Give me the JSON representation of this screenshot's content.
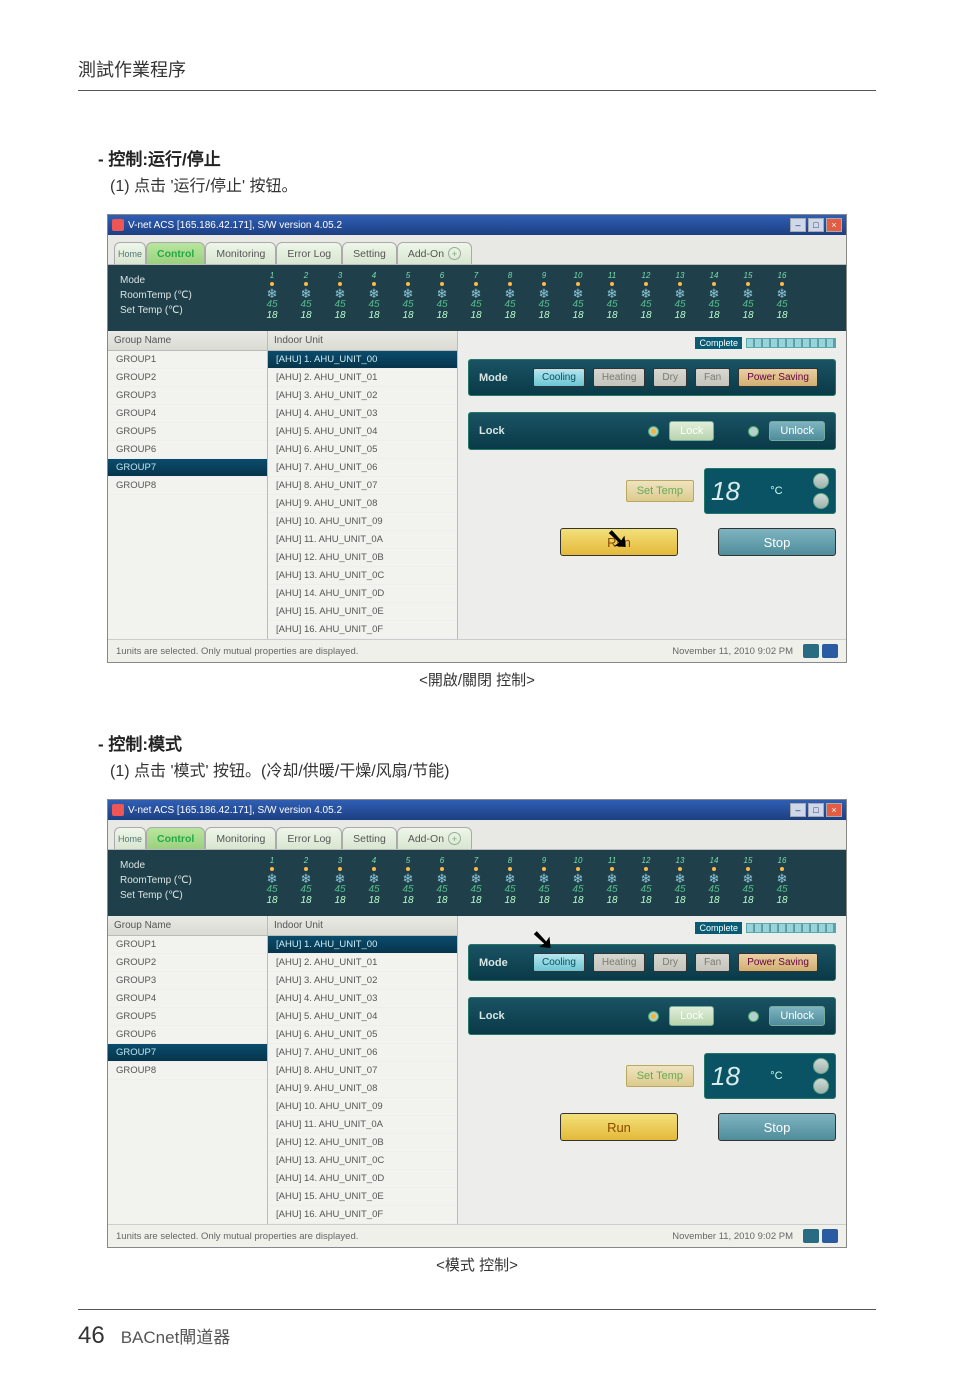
{
  "doc": {
    "header": "測試作業程序",
    "page_number": "46",
    "footer_title": "BACnet閘道器"
  },
  "section1": {
    "heading": "- 控制:运行/停止",
    "desc": "(1) 点击 '运行/停止' 按钮。",
    "caption": "<開啟/關閉 控制>"
  },
  "section2": {
    "heading": "- 控制:模式",
    "desc": "(1) 点击 '模式' 按钮。(冷却/供暖/干燥/风扇/节能)",
    "caption": "<模式 控制>"
  },
  "win": {
    "title": "V-net ACS [165.186.42.171],  S/W version 4.05.2",
    "tabs": {
      "home_icon": "Home",
      "control": "Control",
      "monitoring": "Monitoring",
      "errorlog": "Error Log",
      "setting": "Setting",
      "addon": "Add-On"
    },
    "strip": {
      "mode": "Mode",
      "roomtemp": "RoomTemp (℃)",
      "settemp": "Set Temp  (℃)",
      "cols": [
        "1",
        "2",
        "3",
        "4",
        "5",
        "6",
        "7",
        "8",
        "9",
        "10",
        "11",
        "12",
        "13",
        "14",
        "15",
        "16"
      ],
      "v1": "45",
      "v2": "18",
      "snow_glyph": "❄"
    },
    "groups_header": "Group Name",
    "units_header": "Indoor Unit",
    "groups": [
      "GROUP1",
      "GROUP2",
      "GROUP3",
      "GROUP4",
      "GROUP5",
      "GROUP6",
      "GROUP7",
      "GROUP8"
    ],
    "groups_selected": "GROUP7",
    "units": [
      "[AHU] 1. AHU_UNIT_00",
      "[AHU] 2. AHU_UNIT_01",
      "[AHU] 3. AHU_UNIT_02",
      "[AHU] 4. AHU_UNIT_03",
      "[AHU] 5. AHU_UNIT_04",
      "[AHU] 6. AHU_UNIT_05",
      "[AHU] 7. AHU_UNIT_06",
      "[AHU] 8. AHU_UNIT_07",
      "[AHU] 9. AHU_UNIT_08",
      "[AHU] 10. AHU_UNIT_09",
      "[AHU] 11. AHU_UNIT_0A",
      "[AHU] 12. AHU_UNIT_0B",
      "[AHU] 13. AHU_UNIT_0C",
      "[AHU] 14. AHU_UNIT_0D",
      "[AHU] 15. AHU_UNIT_0E",
      "[AHU] 16. AHU_UNIT_0F"
    ],
    "units_selected": "[AHU] 1. AHU_UNIT_00",
    "complete": "Complete",
    "mode_panel": {
      "label": "Mode",
      "cooling": "Cooling",
      "heating": "Heating",
      "dry": "Dry",
      "fan": "Fan",
      "powersaving": "Power\nSaving"
    },
    "lock_panel": {
      "label": "Lock",
      "lock": "Lock",
      "unlock": "Unlock"
    },
    "settemp_btn": "Set Temp",
    "temp_value": "18",
    "temp_unit": "°C",
    "run": "Run",
    "stop": "Stop",
    "status_left": "1units are selected. Only mutual properties are displayed.",
    "status_time": "November 11, 2010  9:02 PM"
  }
}
